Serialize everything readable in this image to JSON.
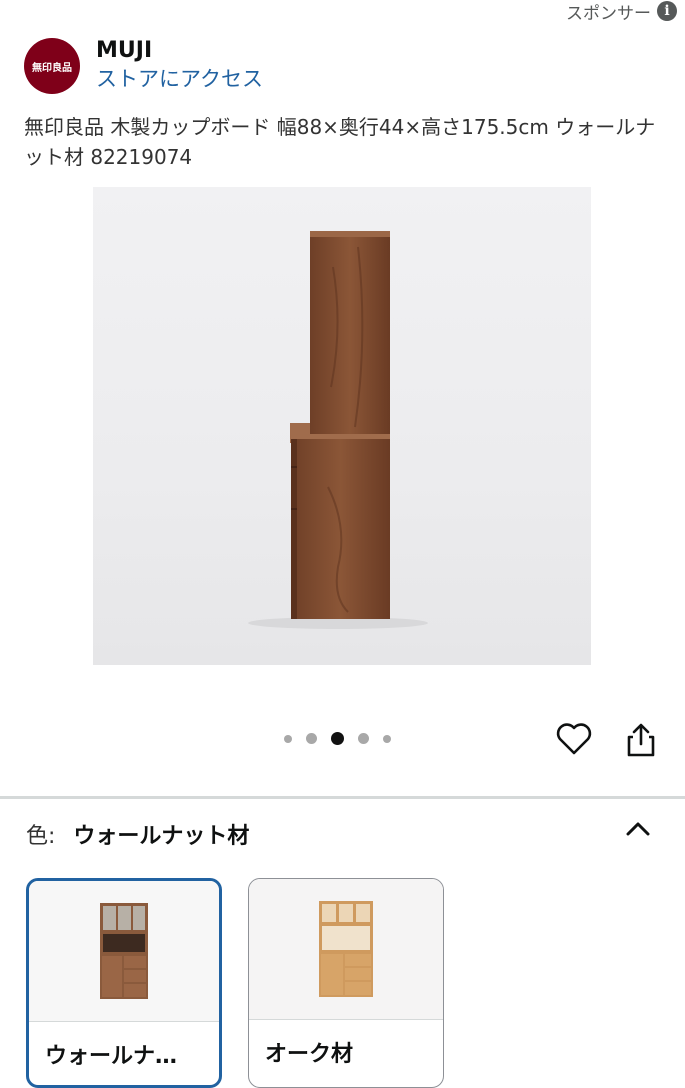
{
  "sponsor": {
    "label": "スポンサー",
    "icon": "info-icon"
  },
  "brand": {
    "logo_text": "無印良品",
    "logo_color": "#7f0019",
    "name": "MUJI",
    "store_link": "ストアにアクセス",
    "link_color": "#2162a1"
  },
  "product": {
    "title": "無印良品 木製カップボード 幅88×奥行44×高さ175.5cm ウォールナット材 82219074"
  },
  "carousel": {
    "total": 5,
    "active_index": 2
  },
  "actions": {
    "wishlist_icon": "heart-icon",
    "share_icon": "share-icon"
  },
  "variation": {
    "label": "色:",
    "selected_value": "ウォールナット材",
    "collapse_icon": "chevron-up-icon",
    "options": [
      {
        "label": "ウォールナ…",
        "selected": true,
        "wood_color": "#8a5a3c"
      },
      {
        "label": "オーク材",
        "selected": false,
        "wood_color": "#cf9a5e"
      }
    ]
  }
}
